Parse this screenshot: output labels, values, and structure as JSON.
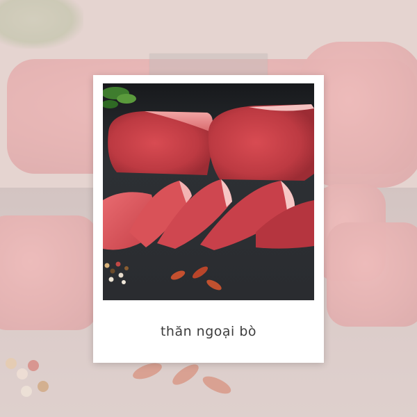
{
  "card": {
    "caption": "thăn ngoại bò"
  },
  "colors": {
    "background": "#d9c6c2",
    "meat": "#c8484e",
    "slate": "#2e3135",
    "card": "#ffffff",
    "caption_text": "#3c3c3c"
  },
  "icons": [
    "tape-strip",
    "herb-sprig",
    "peppercorn",
    "chili-flake"
  ]
}
